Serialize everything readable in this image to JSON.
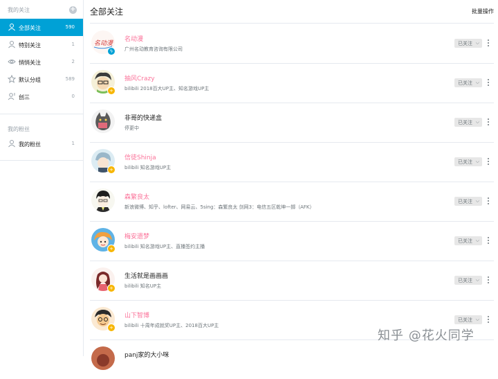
{
  "sidebar": {
    "follow_section": "我的关注",
    "items": [
      {
        "label": "全部关注",
        "count": "590"
      },
      {
        "label": "特别关注",
        "count": "1"
      },
      {
        "label": "悄悄关注",
        "count": "2"
      },
      {
        "label": "默认分组",
        "count": "589"
      },
      {
        "label": "创三",
        "count": "0"
      }
    ],
    "fans_section": "我的粉丝",
    "fans_items": [
      {
        "label": "我的粉丝",
        "count": "1"
      }
    ]
  },
  "main": {
    "title": "全部关注",
    "batch_label": "批量操作",
    "follow_label": "已关注",
    "users": [
      {
        "name": "名动漫",
        "desc": "广州名动教育咨询有限公司"
      },
      {
        "name": "抽风Crazy",
        "desc": "bilibili 2018百大UP主、知名游戏UP主"
      },
      {
        "name": "非哥的快递盒",
        "desc": "停更中"
      },
      {
        "name": "信徒Shinja",
        "desc": "bilibili 知名游戏UP主"
      },
      {
        "name": "森繁良太",
        "desc": "新浪微博、知乎、lofter、网易云、5sing：森繁良太 剑网3：电信五区乾坤一掷（AFK）"
      },
      {
        "name": "梅安遗梦",
        "desc": "bilibili 知名游戏UP主、直播签约主播"
      },
      {
        "name": "生活就是画画画",
        "desc": "bilibili 知名UP主"
      },
      {
        "name": "山下智博",
        "desc": "bilibili 十周年成就奖UP主、2018百大UP主"
      },
      {
        "name": "panj家的大小咪",
        "desc": ""
      }
    ]
  },
  "watermark": "知乎 @花火同学",
  "colors": {
    "accent": "#00a1d6",
    "pink": "#fb7299",
    "verified_blue": "#00a1d6",
    "up_badge": "#f7b500"
  }
}
